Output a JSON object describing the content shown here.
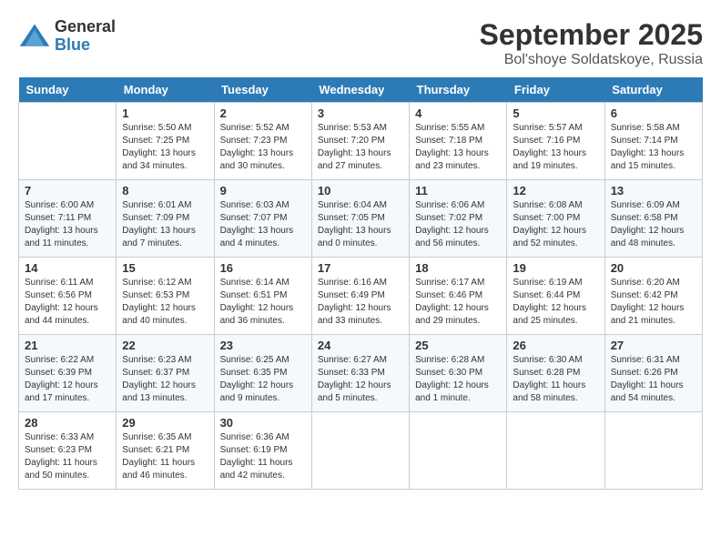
{
  "header": {
    "logo_general": "General",
    "logo_blue": "Blue",
    "month": "September 2025",
    "location": "Bol'shoye Soldatskoye, Russia"
  },
  "days_of_week": [
    "Sunday",
    "Monday",
    "Tuesday",
    "Wednesday",
    "Thursday",
    "Friday",
    "Saturday"
  ],
  "weeks": [
    [
      {
        "day": "",
        "sunrise": "",
        "sunset": "",
        "daylight": ""
      },
      {
        "day": "1",
        "sunrise": "5:50 AM",
        "sunset": "7:25 PM",
        "daylight": "13 hours and 34 minutes."
      },
      {
        "day": "2",
        "sunrise": "5:52 AM",
        "sunset": "7:23 PM",
        "daylight": "13 hours and 30 minutes."
      },
      {
        "day": "3",
        "sunrise": "5:53 AM",
        "sunset": "7:20 PM",
        "daylight": "13 hours and 27 minutes."
      },
      {
        "day": "4",
        "sunrise": "5:55 AM",
        "sunset": "7:18 PM",
        "daylight": "13 hours and 23 minutes."
      },
      {
        "day": "5",
        "sunrise": "5:57 AM",
        "sunset": "7:16 PM",
        "daylight": "13 hours and 19 minutes."
      },
      {
        "day": "6",
        "sunrise": "5:58 AM",
        "sunset": "7:14 PM",
        "daylight": "13 hours and 15 minutes."
      }
    ],
    [
      {
        "day": "7",
        "sunrise": "6:00 AM",
        "sunset": "7:11 PM",
        "daylight": "13 hours and 11 minutes."
      },
      {
        "day": "8",
        "sunrise": "6:01 AM",
        "sunset": "7:09 PM",
        "daylight": "13 hours and 7 minutes."
      },
      {
        "day": "9",
        "sunrise": "6:03 AM",
        "sunset": "7:07 PM",
        "daylight": "13 hours and 4 minutes."
      },
      {
        "day": "10",
        "sunrise": "6:04 AM",
        "sunset": "7:05 PM",
        "daylight": "13 hours and 0 minutes."
      },
      {
        "day": "11",
        "sunrise": "6:06 AM",
        "sunset": "7:02 PM",
        "daylight": "12 hours and 56 minutes."
      },
      {
        "day": "12",
        "sunrise": "6:08 AM",
        "sunset": "7:00 PM",
        "daylight": "12 hours and 52 minutes."
      },
      {
        "day": "13",
        "sunrise": "6:09 AM",
        "sunset": "6:58 PM",
        "daylight": "12 hours and 48 minutes."
      }
    ],
    [
      {
        "day": "14",
        "sunrise": "6:11 AM",
        "sunset": "6:56 PM",
        "daylight": "12 hours and 44 minutes."
      },
      {
        "day": "15",
        "sunrise": "6:12 AM",
        "sunset": "6:53 PM",
        "daylight": "12 hours and 40 minutes."
      },
      {
        "day": "16",
        "sunrise": "6:14 AM",
        "sunset": "6:51 PM",
        "daylight": "12 hours and 36 minutes."
      },
      {
        "day": "17",
        "sunrise": "6:16 AM",
        "sunset": "6:49 PM",
        "daylight": "12 hours and 33 minutes."
      },
      {
        "day": "18",
        "sunrise": "6:17 AM",
        "sunset": "6:46 PM",
        "daylight": "12 hours and 29 minutes."
      },
      {
        "day": "19",
        "sunrise": "6:19 AM",
        "sunset": "6:44 PM",
        "daylight": "12 hours and 25 minutes."
      },
      {
        "day": "20",
        "sunrise": "6:20 AM",
        "sunset": "6:42 PM",
        "daylight": "12 hours and 21 minutes."
      }
    ],
    [
      {
        "day": "21",
        "sunrise": "6:22 AM",
        "sunset": "6:39 PM",
        "daylight": "12 hours and 17 minutes."
      },
      {
        "day": "22",
        "sunrise": "6:23 AM",
        "sunset": "6:37 PM",
        "daylight": "12 hours and 13 minutes."
      },
      {
        "day": "23",
        "sunrise": "6:25 AM",
        "sunset": "6:35 PM",
        "daylight": "12 hours and 9 minutes."
      },
      {
        "day": "24",
        "sunrise": "6:27 AM",
        "sunset": "6:33 PM",
        "daylight": "12 hours and 5 minutes."
      },
      {
        "day": "25",
        "sunrise": "6:28 AM",
        "sunset": "6:30 PM",
        "daylight": "12 hours and 1 minute."
      },
      {
        "day": "26",
        "sunrise": "6:30 AM",
        "sunset": "6:28 PM",
        "daylight": "11 hours and 58 minutes."
      },
      {
        "day": "27",
        "sunrise": "6:31 AM",
        "sunset": "6:26 PM",
        "daylight": "11 hours and 54 minutes."
      }
    ],
    [
      {
        "day": "28",
        "sunrise": "6:33 AM",
        "sunset": "6:23 PM",
        "daylight": "11 hours and 50 minutes."
      },
      {
        "day": "29",
        "sunrise": "6:35 AM",
        "sunset": "6:21 PM",
        "daylight": "11 hours and 46 minutes."
      },
      {
        "day": "30",
        "sunrise": "6:36 AM",
        "sunset": "6:19 PM",
        "daylight": "11 hours and 42 minutes."
      },
      {
        "day": "",
        "sunrise": "",
        "sunset": "",
        "daylight": ""
      },
      {
        "day": "",
        "sunrise": "",
        "sunset": "",
        "daylight": ""
      },
      {
        "day": "",
        "sunrise": "",
        "sunset": "",
        "daylight": ""
      },
      {
        "day": "",
        "sunrise": "",
        "sunset": "",
        "daylight": ""
      }
    ]
  ]
}
